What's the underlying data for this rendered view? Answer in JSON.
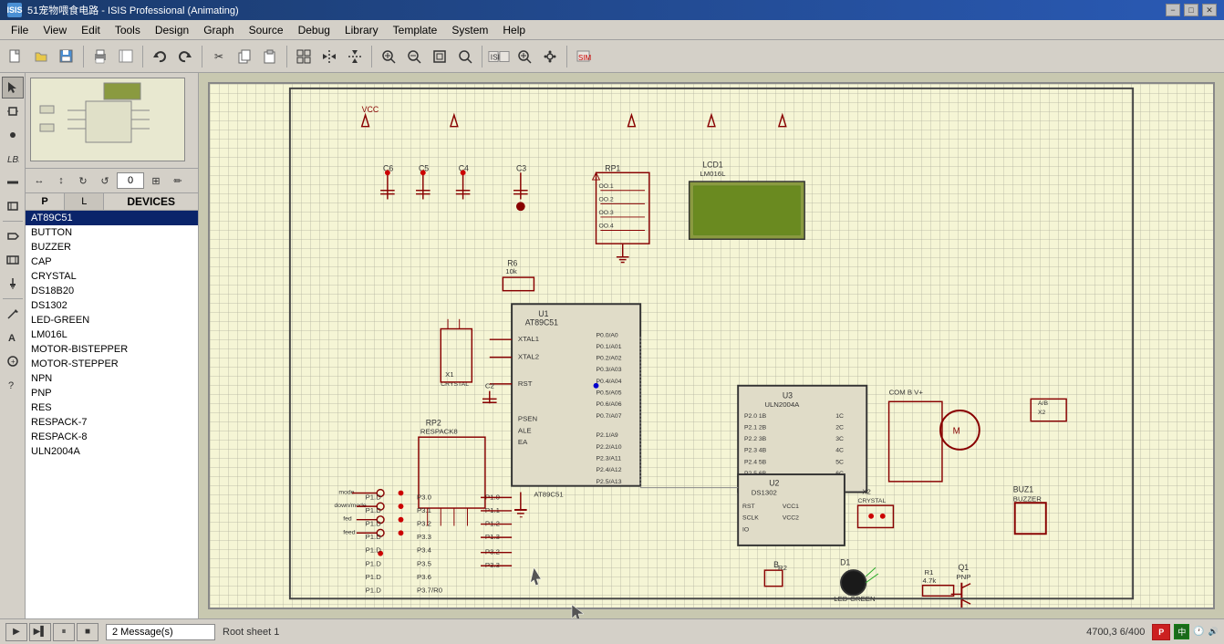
{
  "titlebar": {
    "title": "51宠物喂食电路 - ISIS Professional (Animating)",
    "icon": "ISIS",
    "minimize": "−",
    "maximize": "□",
    "close": "✕"
  },
  "menu": {
    "items": [
      "File",
      "View",
      "Edit",
      "Tools",
      "Design",
      "Graph",
      "Source",
      "Debug",
      "Library",
      "Template",
      "System",
      "Help"
    ]
  },
  "toolbar": {
    "buttons": [
      "📄",
      "📁",
      "💾",
      "🖨️",
      "✂️",
      "📋",
      "↩️",
      "↪️",
      "🔍",
      "🔎",
      "📐",
      "📏",
      "⬜",
      "⭕",
      "〰️",
      "🔲",
      "✏️",
      "🗑️",
      "⚙️"
    ]
  },
  "sidebar": {
    "tabs": [
      "P",
      "L"
    ],
    "devices_label": "DEVICES",
    "devices": [
      {
        "name": "AT89C51",
        "selected": true
      },
      {
        "name": "BUTTON",
        "selected": false
      },
      {
        "name": "BUZZER",
        "selected": false
      },
      {
        "name": "CAP",
        "selected": false
      },
      {
        "name": "CRYSTAL",
        "selected": false
      },
      {
        "name": "DS18B20",
        "selected": false
      },
      {
        "name": "DS1302",
        "selected": false
      },
      {
        "name": "LED-GREEN",
        "selected": false
      },
      {
        "name": "LM016L",
        "selected": false
      },
      {
        "name": "MOTOR-BISTEPPER",
        "selected": false
      },
      {
        "name": "MOTOR-STEPPER",
        "selected": false
      },
      {
        "name": "NPN",
        "selected": false
      },
      {
        "name": "PNP",
        "selected": false
      },
      {
        "name": "RES",
        "selected": false
      },
      {
        "name": "RESPACK-7",
        "selected": false
      },
      {
        "name": "RESPACK-8",
        "selected": false
      },
      {
        "name": "ULN2004A",
        "selected": false
      }
    ],
    "angle": "0"
  },
  "left_toolbar": {
    "tools": [
      "↖",
      "↕",
      "🔲",
      "🏷",
      "↗",
      "↙",
      "✏️",
      "↩",
      "📐",
      "∿",
      "▦",
      "ABC",
      "∥",
      "⊕",
      "?"
    ]
  },
  "status": {
    "message": "2 Message(s)",
    "sheet": "Root sheet 1",
    "coords": "4700,3 6/400"
  }
}
